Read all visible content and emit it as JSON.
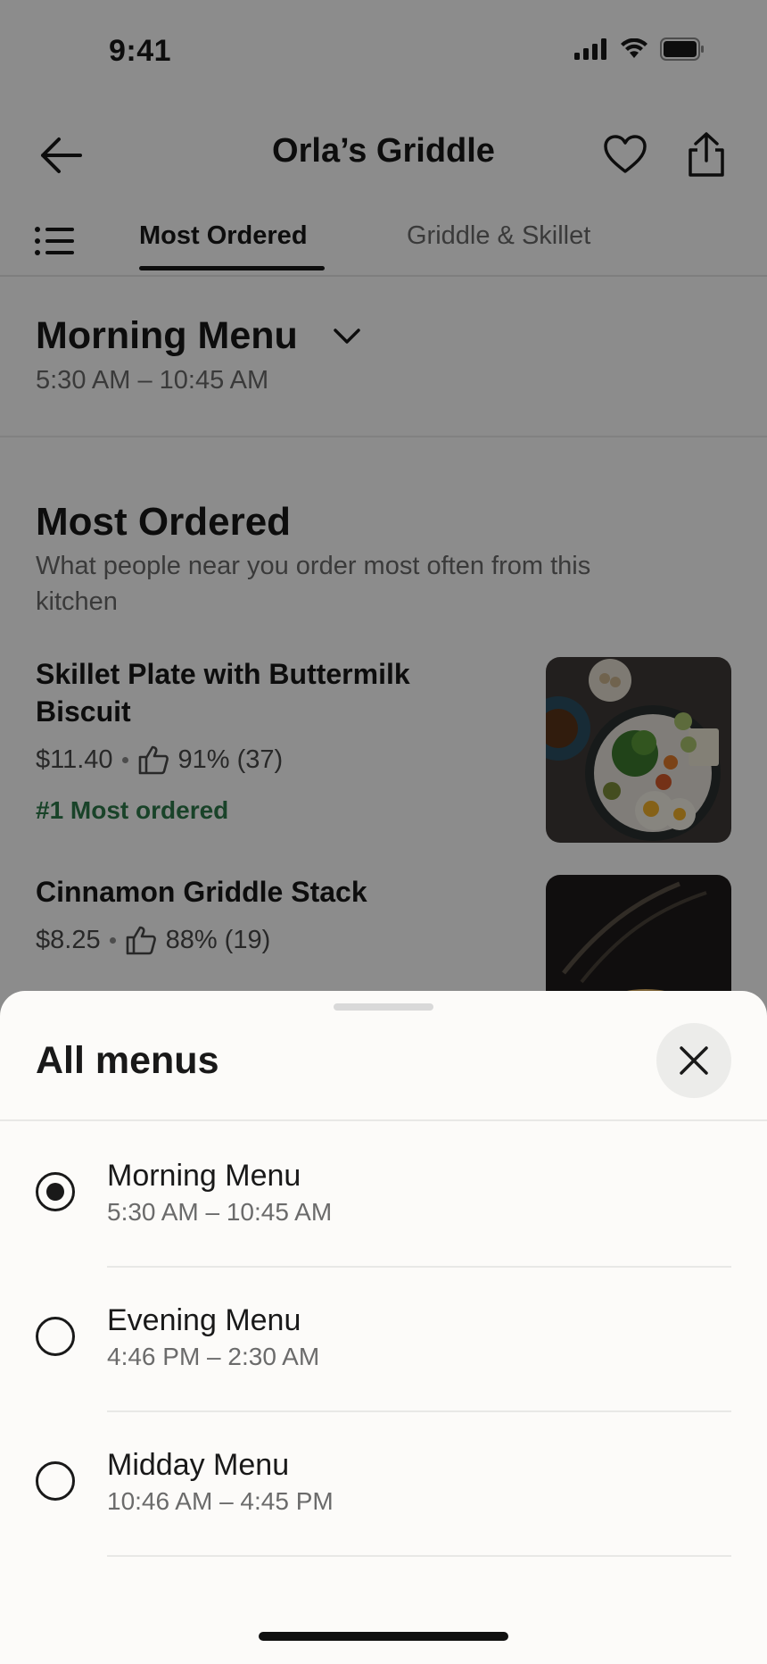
{
  "status_bar": {
    "time": "9:41"
  },
  "header": {
    "title": "Orla’s Griddle"
  },
  "tabs": [
    {
      "label": "Most Ordered",
      "active": true
    },
    {
      "label": "Griddle & Skillet",
      "active": false
    }
  ],
  "menu_selector": {
    "title": "Morning Menu",
    "hours": "5:30 AM – 10:45 AM"
  },
  "section": {
    "title": "Most Ordered",
    "subtitle": "What people near you order most often from this kitchen"
  },
  "items": [
    {
      "name": "Skillet Plate with Buttermilk Biscuit",
      "price": "$11.40",
      "rating": "91% (37)",
      "badge": "#1 Most ordered"
    },
    {
      "name": "Cinnamon Griddle Stack",
      "price": "$8.25",
      "rating": "88% (19)"
    }
  ],
  "sheet": {
    "title": "All menus",
    "options": [
      {
        "name": "Morning Menu",
        "hours": "5:30 AM – 10:45 AM",
        "selected": true
      },
      {
        "name": "Evening Menu",
        "hours": "4:46 PM – 2:30 AM",
        "selected": false
      },
      {
        "name": "Midday Menu",
        "hours": "10:46 AM – 4:45 PM",
        "selected": false
      }
    ]
  },
  "colors": {
    "accent_green": "#2f7a4c",
    "text": "#191919",
    "muted": "#6b6b6b",
    "sheet_bg": "#fcfbf9"
  },
  "icons": [
    "back-arrow-icon",
    "heart-icon",
    "share-icon",
    "list-icon",
    "chevron-down-icon",
    "thumbs-up-icon",
    "close-icon",
    "signal-icon",
    "wifi-icon",
    "battery-icon"
  ]
}
